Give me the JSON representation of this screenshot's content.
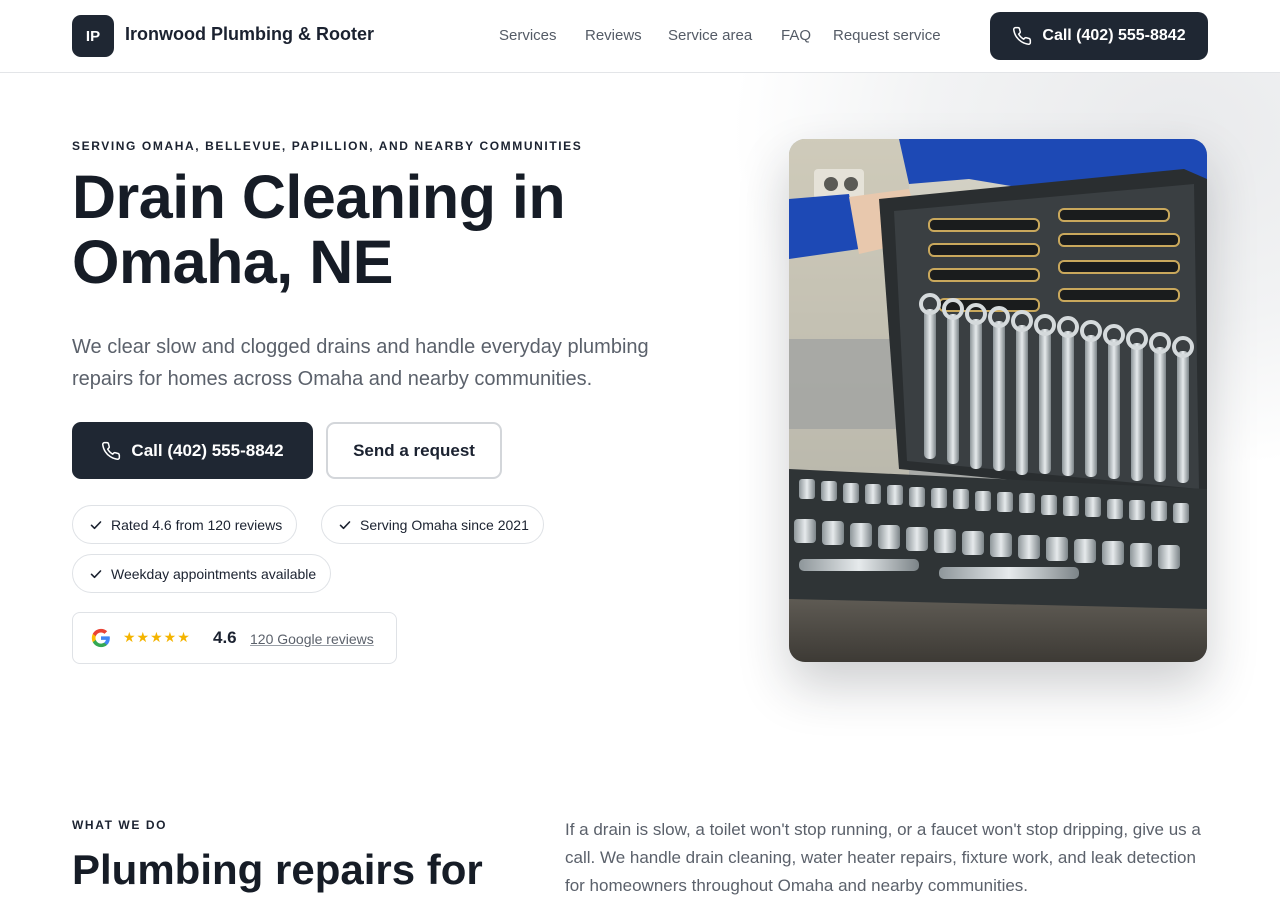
{
  "brand": {
    "initials": "IP",
    "name": "Ironwood Plumbing & Rooter"
  },
  "nav": {
    "items": [
      "Services",
      "Reviews",
      "Service area",
      "FAQ",
      "Request service"
    ]
  },
  "header": {
    "call_label": "Call (402) 555-8842"
  },
  "hero": {
    "eyebrow": "SERVING OMAHA, BELLEVUE, PAPILLION, AND NEARBY COMMUNITIES",
    "title": "Drain Cleaning in Omaha, NE",
    "description": "We clear slow and clogged drains and handle everyday plumbing repairs for homes across Omaha and nearby communities.",
    "call_label": "Call (402) 555-8842",
    "request_label": "Send a request",
    "badges": [
      "Rated 4.6 from 120 reviews",
      "Serving Omaha since 2021",
      "Weekday appointments available"
    ],
    "rating": {
      "stars": "★★★★★",
      "value": "4.6",
      "reviews_link": "120 Google reviews"
    }
  },
  "section2": {
    "eyebrow": "WHAT WE DO",
    "title": "Plumbing repairs for",
    "body": "If a drain is slow, a toilet won't stop running, or a faucet won't stop dripping, give us a call. We handle drain cleaning, water heater repairs, fixture work, and leak detection for homeowners throughout Omaha and nearby communities."
  },
  "colors": {
    "primary": "#1f2733",
    "text": "#1b2230",
    "muted": "#5b616b",
    "border": "#dfe2e6",
    "star": "#f4b400"
  },
  "icons": [
    "phone-icon",
    "check-icon",
    "google-icon"
  ]
}
